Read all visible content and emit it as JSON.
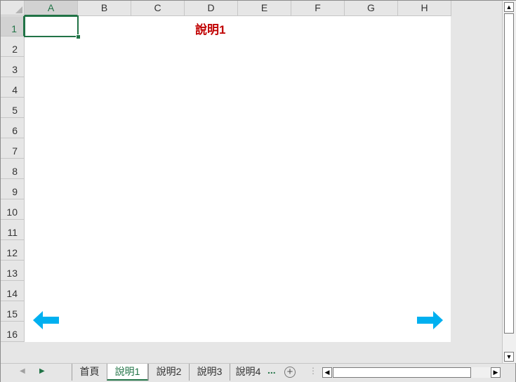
{
  "columns": [
    "A",
    "B",
    "C",
    "D",
    "E",
    "F",
    "G",
    "H"
  ],
  "rows": [
    "1",
    "2",
    "3",
    "4",
    "5",
    "6",
    "7",
    "8",
    "9",
    "10",
    "11",
    "12",
    "13",
    "14",
    "15",
    "16"
  ],
  "selected_cell": "A1",
  "title_text": "說明1",
  "arrow_color": "#00b0f0",
  "title_color": "#c00000",
  "accent_color": "#217346",
  "tabs": {
    "items": [
      "首頁",
      "說明1",
      "說明2",
      "說明3",
      "說明4"
    ],
    "active": "說明1",
    "overflow": "...",
    "add_symbol": "+",
    "split_symbol": "⋮"
  },
  "icons": {
    "scroll_up": "▲",
    "scroll_down": "▼",
    "scroll_left": "◀",
    "scroll_right": "▶",
    "tab_prev": "◀",
    "tab_next": "▶"
  }
}
